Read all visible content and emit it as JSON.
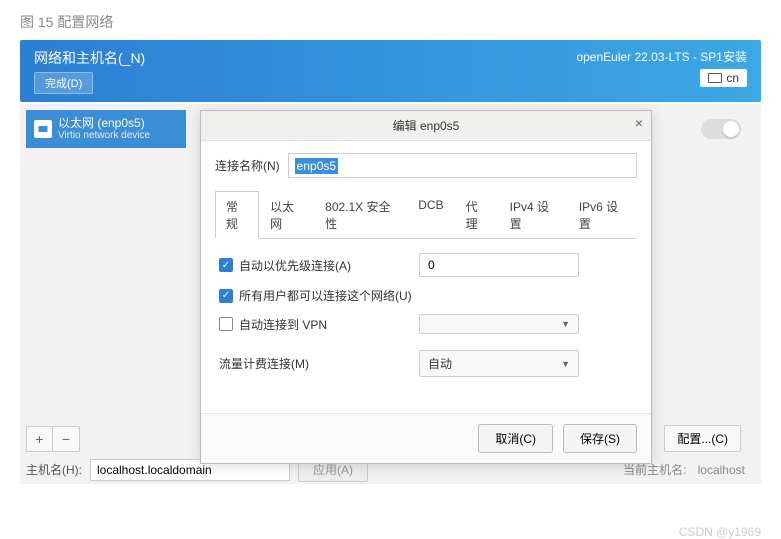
{
  "figure_caption": "图 15 配置网络",
  "header": {
    "title": "网络和主机名(_N)",
    "done": "完成(D)",
    "installer": "openEuler 22.03-LTS - SP1安装",
    "lang": "cn"
  },
  "network": {
    "item_name": "以太网 (enp0s5)",
    "item_sub": "Virtio network device",
    "add_symbol": "+",
    "remove_symbol": "−",
    "config_btn": "配置...(C)"
  },
  "host": {
    "label": "主机名(H):",
    "value": "localhost.localdomain",
    "apply": "应用(A)",
    "current_label": "当前主机名:",
    "current_value": "localhost"
  },
  "dialog": {
    "title": "编辑 enp0s5",
    "name_label": "连接名称(N)",
    "name_value": "enp0s5",
    "tabs": [
      "常规",
      "以太网",
      "802.1X 安全性",
      "DCB",
      "代理",
      "IPv4 设置",
      "IPv6 设置"
    ],
    "active_tab": 0,
    "auto_priority_label": "自动以优先级连接(A)",
    "priority_value": "0",
    "all_users_label": "所有用户都可以连接这个网络(U)",
    "auto_vpn_label": "自动连接到 VPN",
    "metered_label": "流量计费连接(M)",
    "metered_value": "自动",
    "cancel": "取消(C)",
    "save": "保存(S)"
  },
  "watermark": "CSDN @y1969"
}
